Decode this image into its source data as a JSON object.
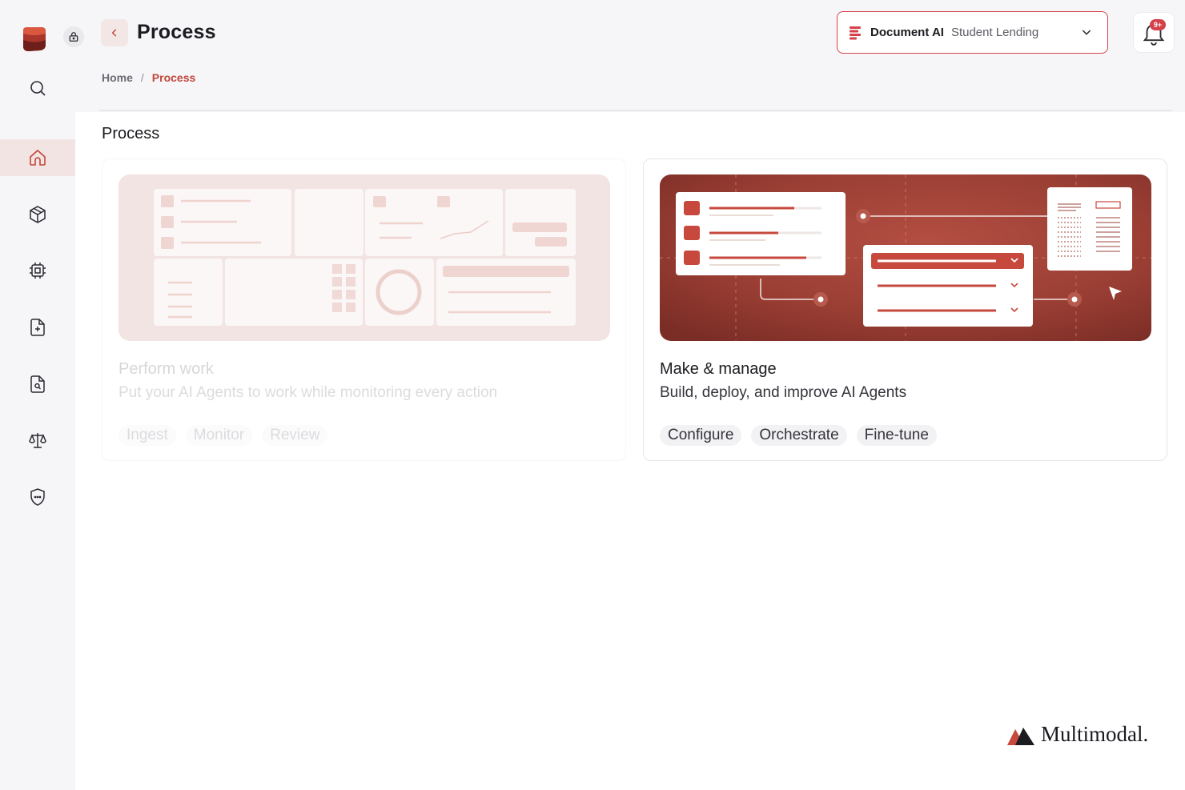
{
  "header": {
    "title": "Process",
    "breadcrumb": {
      "home": "Home",
      "separator": "/",
      "current": "Process"
    },
    "selector": {
      "product": "Document AI",
      "workflow": "Student Lending"
    },
    "notifications": {
      "badge": "9+"
    }
  },
  "sidebar": {
    "items": [
      {
        "icon": "search-icon"
      },
      {
        "icon": "home-icon",
        "active": true
      },
      {
        "icon": "cube-icon"
      },
      {
        "icon": "chip-icon"
      },
      {
        "icon": "file-plus-icon"
      },
      {
        "icon": "file-search-icon"
      },
      {
        "icon": "scale-icon"
      },
      {
        "icon": "shield-icon"
      }
    ]
  },
  "main": {
    "section_title": "Process",
    "cards": [
      {
        "title": "Perform work",
        "description": "Put your AI Agents to work while monitoring every action",
        "tags": [
          "Ingest",
          "Monitor",
          "Review"
        ],
        "state": "disabled"
      },
      {
        "title": "Make & manage",
        "description": "Build, deploy, and improve AI Agents",
        "tags": [
          "Configure",
          "Orchestrate",
          "Fine-tune"
        ],
        "state": "enabled"
      }
    ]
  },
  "brand": {
    "name": "Multimodal."
  },
  "colors": {
    "accent": "#d4414a",
    "hero": "#9b3f35",
    "link": "#c2463a"
  }
}
